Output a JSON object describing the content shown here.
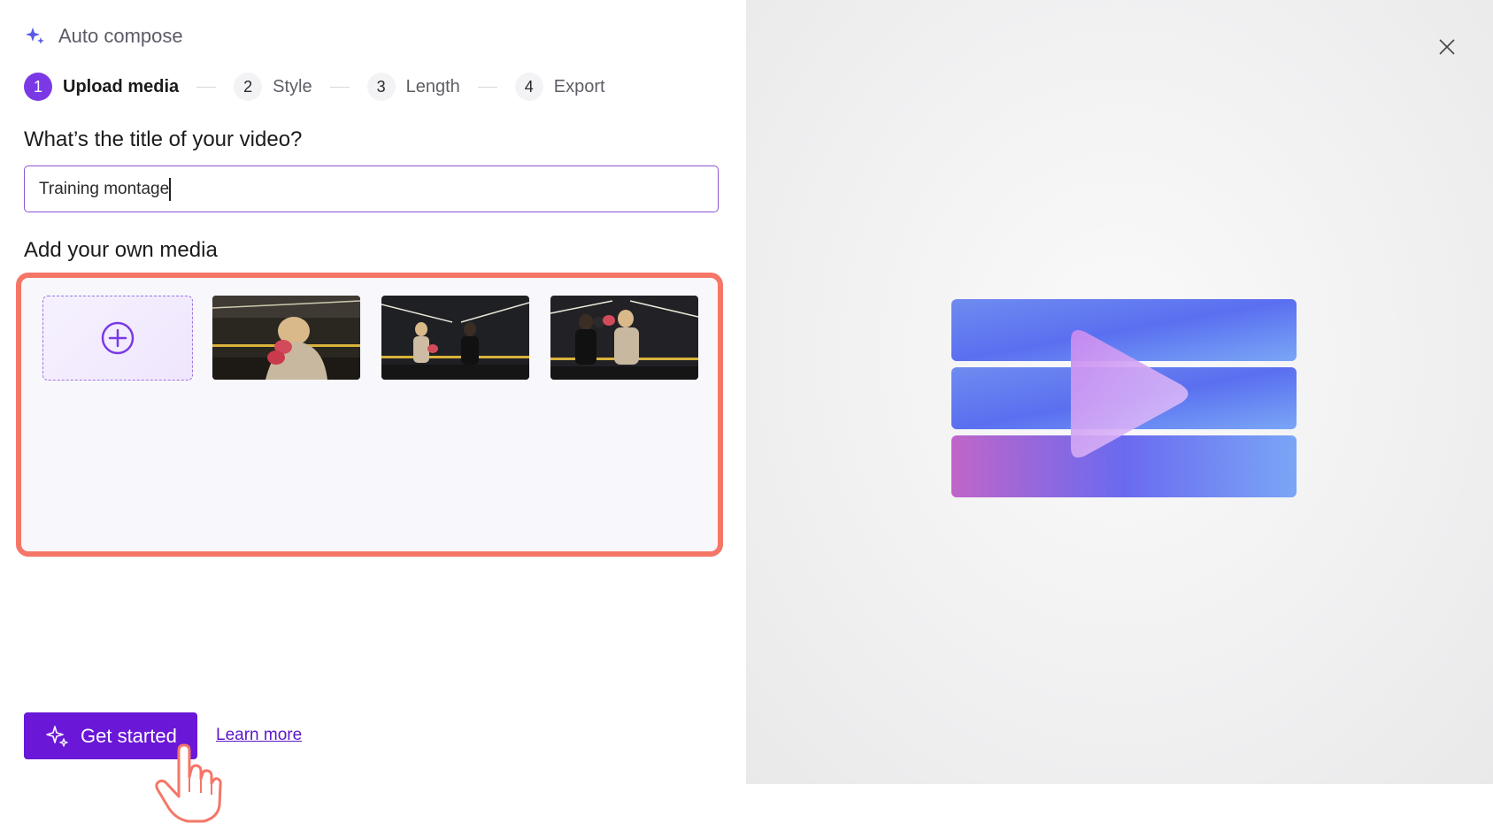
{
  "header": {
    "title": "Auto compose",
    "icon": "sparkle-icon"
  },
  "stepper": {
    "steps": [
      {
        "number": "1",
        "label": "Upload media",
        "active": true
      },
      {
        "number": "2",
        "label": "Style",
        "active": false
      },
      {
        "number": "3",
        "label": "Length",
        "active": false
      },
      {
        "number": "4",
        "label": "Export",
        "active": false
      }
    ]
  },
  "title_section": {
    "question": "What’s the title of your video?",
    "input_value": "Training montage"
  },
  "media_section": {
    "heading": "Add your own media",
    "add_icon": "plus-circle-icon",
    "thumbnails": [
      "boxing-training-clip-1",
      "boxing-training-clip-2",
      "boxing-training-clip-3"
    ]
  },
  "actions": {
    "get_started_label": "Get started",
    "learn_more_label": "Learn more"
  },
  "colors": {
    "accent": "#6a17d8",
    "highlight_border": "#f57566",
    "active_step": "#7b39e6"
  }
}
